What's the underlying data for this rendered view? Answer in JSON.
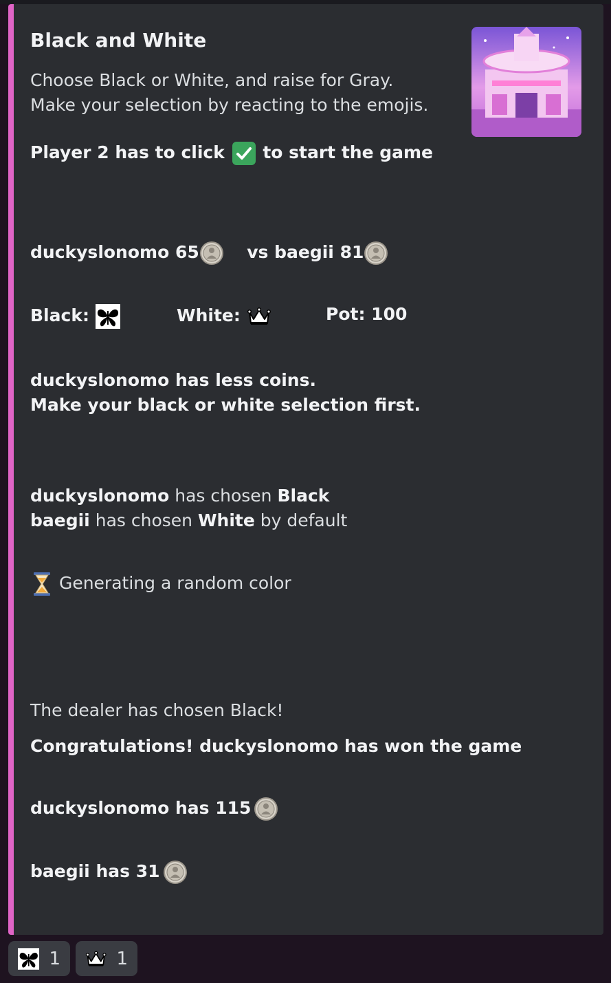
{
  "embed": {
    "accent_color": "#e064c6",
    "title": "Black and White",
    "description_line1": "Choose Black or White, and raise for Gray.",
    "description_line2": "Make your selection by reacting to the emojis.",
    "start_prefix": "Player 2 has to click",
    "start_suffix": "to start the game",
    "start_icon": "check-mark-button-icon",
    "thumbnail_icon": "casino-building-image",
    "player1_name": "duckyslonomo",
    "player1_coins": "65",
    "vs_label": "vs",
    "player2_name": "baegii",
    "player2_coins": "81",
    "black_label": "Black:",
    "black_icon": "butterfly-icon",
    "white_label": "White:",
    "white_icon": "crown-icon",
    "pot_label": "Pot:",
    "pot_value": "100",
    "less_coins_line1": "duckyslonomo has less coins.",
    "less_coins_line2": "Make your black or white selection first.",
    "choice1_name": "duckyslonomo",
    "choice1_text": "has chosen",
    "choice1_color": "Black",
    "choice2_name": "baegii",
    "choice2_text": "has chosen",
    "choice2_color": "White",
    "choice2_suffix": "by default",
    "generating_icon": "hourglass-icon",
    "generating_text": "Generating a random color",
    "dealer_text": "The dealer has chosen Black!",
    "congrats_text": "Congratulations! duckyslonomo has won the game",
    "final1_text": "duckyslonomo has 115",
    "final2_text": "baegii has 31",
    "coin_icon": "coin-icon"
  },
  "reactions": [
    {
      "icon": "butterfly-icon",
      "count": "1"
    },
    {
      "icon": "crown-icon",
      "count": "1"
    }
  ]
}
